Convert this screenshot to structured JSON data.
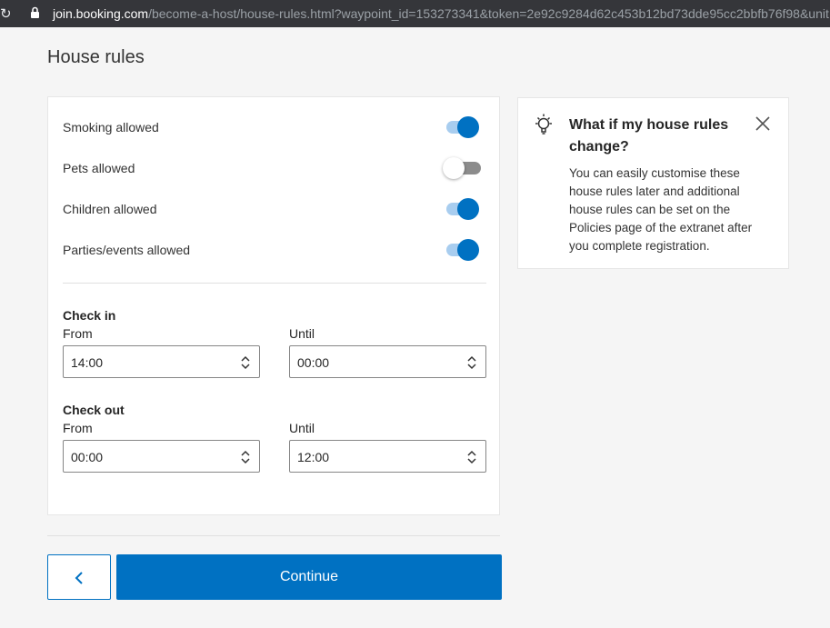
{
  "browser": {
    "url_host": "join.booking.com",
    "url_path": "/become-a-host/house-rules.html?waypoint_id=153273341&token=2e92c9284d62c453b12bd73dde95cc2bbfb76f98&unit"
  },
  "page": {
    "title": "House rules"
  },
  "rules": [
    {
      "label": "Smoking allowed",
      "enabled": true
    },
    {
      "label": "Pets allowed",
      "enabled": false
    },
    {
      "label": "Children allowed",
      "enabled": true
    },
    {
      "label": "Parties/events allowed",
      "enabled": true
    }
  ],
  "check_in": {
    "heading": "Check in",
    "from_label": "From",
    "from_value": "14:00",
    "until_label": "Until",
    "until_value": "00:00"
  },
  "check_out": {
    "heading": "Check out",
    "from_label": "From",
    "from_value": "00:00",
    "until_label": "Until",
    "until_value": "12:00"
  },
  "tip": {
    "title": "What if my house rules change?",
    "body": "You can easily customise these house rules later and additional house rules can be set on the Policies page of the extranet after you complete registration.",
    "icon": "lightbulb-icon"
  },
  "actions": {
    "continue_label": "Continue",
    "back_icon": "chevron-left-icon"
  },
  "colors": {
    "accent": "#0071c2",
    "toggle_on_track": "#a8cdef",
    "toggle_off_track": "#8c8c8c"
  }
}
